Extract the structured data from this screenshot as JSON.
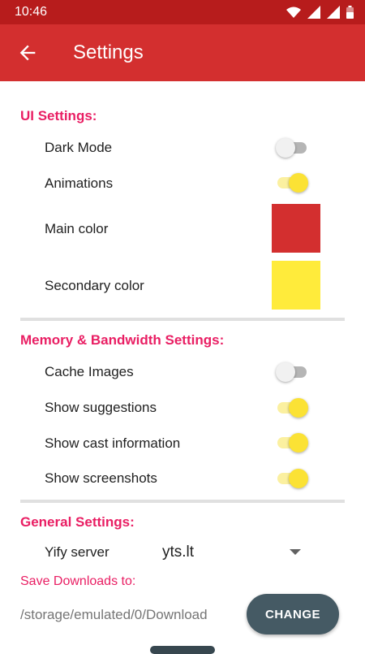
{
  "status_bar": {
    "time": "10:46",
    "icons": [
      "wifi-icon",
      "signal-icon",
      "battery-icon"
    ]
  },
  "app_bar": {
    "title": "Settings",
    "back_icon": "arrow-left-icon",
    "color": "#d32f2f"
  },
  "ui_settings": {
    "title": "UI Settings:",
    "dark_mode": {
      "label": "Dark Mode",
      "on": false
    },
    "animations": {
      "label": "Animations",
      "on": true
    },
    "main_color": {
      "label": "Main color",
      "value": "#d32f2f"
    },
    "secondary_color": {
      "label": "Secondary color",
      "value": "#ffeb3b"
    }
  },
  "memory_settings": {
    "title": "Memory & Bandwidth Settings:",
    "cache_images": {
      "label": "Cache Images",
      "on": false
    },
    "show_suggestions": {
      "label": "Show suggestions",
      "on": true
    },
    "show_cast": {
      "label": "Show cast information",
      "on": true
    },
    "show_screenshots": {
      "label": "Show screenshots",
      "on": true
    }
  },
  "general_settings": {
    "title": "General Settings:",
    "yify_server": {
      "label": "Yify server",
      "value": "yts.lt"
    },
    "save_downloads": {
      "label": "Save Downloads to:",
      "path": "/storage/emulated/0/Download",
      "button": "CHANGE"
    }
  },
  "colors": {
    "accent": "#e91e63",
    "toggle_on": "#fbe235",
    "button": "#455a64"
  }
}
